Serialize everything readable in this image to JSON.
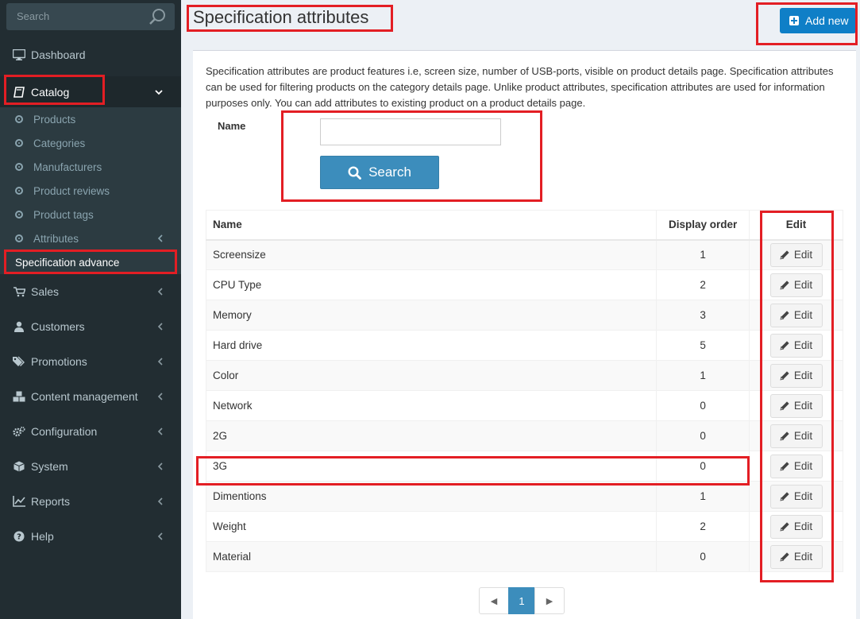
{
  "sidebar": {
    "search_placeholder": "Search",
    "dashboard": "Dashboard",
    "catalog": "Catalog",
    "catalog_items": [
      "Products",
      "Categories",
      "Manufacturers",
      "Product reviews",
      "Product tags",
      "Attributes"
    ],
    "spec_item": "Specification advance",
    "sections": [
      "Sales",
      "Customers",
      "Promotions",
      "Content management",
      "Configuration",
      "System",
      "Reports",
      "Help"
    ]
  },
  "header": {
    "title": "Specification attributes",
    "add_new": "Add new"
  },
  "main": {
    "description": "Specification attributes are product features i.e, screen size, number of USB-ports, visible on product details page. Specification attributes can be used for filtering products on the category details page. Unlike product attributes, specification attributes are used for information purposes only. You can add attributes to existing product on a product details page.",
    "search": {
      "name_label": "Name",
      "name_value": "",
      "button_label": "Search"
    },
    "table": {
      "columns": [
        "Name",
        "Display order",
        "Edit"
      ],
      "edit_label": "Edit",
      "rows": [
        {
          "name": "Screensize",
          "order": "1"
        },
        {
          "name": "CPU Type",
          "order": "2"
        },
        {
          "name": "Memory",
          "order": "3"
        },
        {
          "name": "Hard drive",
          "order": "5"
        },
        {
          "name": "Color",
          "order": "1"
        },
        {
          "name": "Network",
          "order": "0"
        },
        {
          "name": "2G",
          "order": "0"
        },
        {
          "name": "3G",
          "order": "0"
        },
        {
          "name": "Dimentions",
          "order": "1"
        },
        {
          "name": "Weight",
          "order": "2"
        },
        {
          "name": "Material",
          "order": "0"
        }
      ]
    },
    "pager": {
      "prev": "◀",
      "current": "1",
      "next": "▶"
    }
  },
  "colors": {
    "sidebar_bg": "#222d32",
    "accent": "#3c8dbc",
    "add_button": "#0f7fc7",
    "highlight_border": "#e31e24"
  }
}
